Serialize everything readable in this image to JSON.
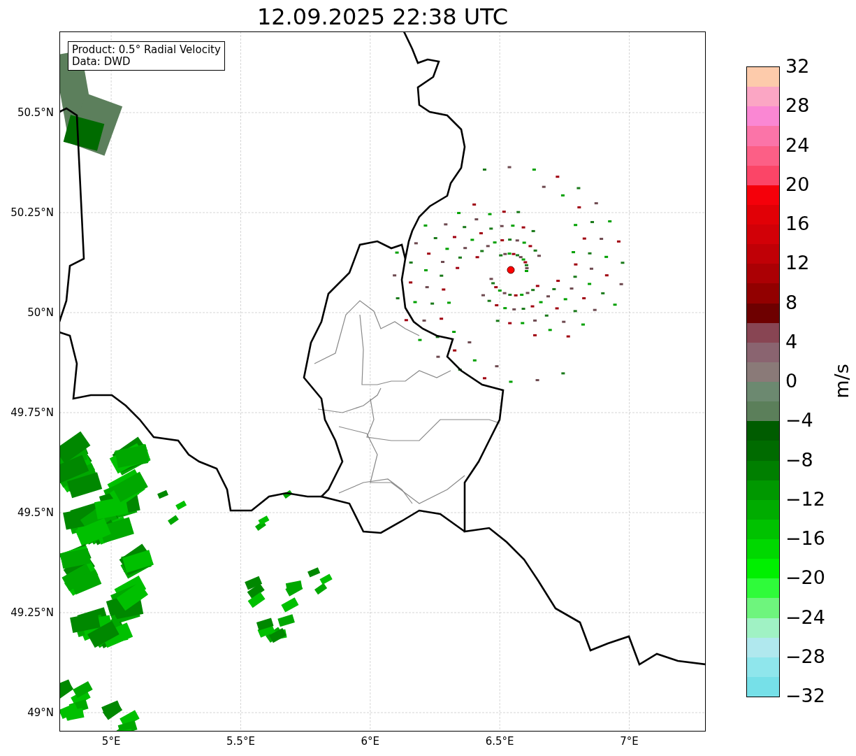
{
  "title": "12.09.2025 22:38 UTC",
  "legend": [
    "Product: 0.5° Radial Velocity",
    "Data: DWD"
  ],
  "y_axis_labels": [
    "50.5°N",
    "50.25°N",
    "50°N",
    "49.75°N",
    "49.5°N",
    "49.25°N",
    "49°N"
  ],
  "x_axis_labels": [
    "5°E",
    "5.5°E",
    "6°E",
    "6.5°E",
    "7°E"
  ],
  "colorbar": {
    "label": "m/s",
    "ticks": [
      "32",
      "28",
      "24",
      "20",
      "16",
      "12",
      "8",
      "4",
      "0",
      "−4",
      "−8",
      "−12",
      "−16",
      "−20",
      "−24",
      "−28",
      "−32"
    ],
    "segments": [
      {
        "color": "#fdcbab"
      },
      {
        "color": "#fba6c4"
      },
      {
        "color": "#fa87d3"
      },
      {
        "color": "#fb74a8"
      },
      {
        "color": "#fc5f86"
      },
      {
        "color": "#fb4567"
      },
      {
        "color": "#f5000a"
      },
      {
        "color": "#e10006"
      },
      {
        "color": "#d20007"
      },
      {
        "color": "#c00006"
      },
      {
        "color": "#ab0004"
      },
      {
        "color": "#920000"
      },
      {
        "color": "#6e0000"
      },
      {
        "color": "#884553"
      },
      {
        "color": "#8a6470"
      },
      {
        "color": "#8a7a78"
      },
      {
        "color": "#6c8970"
      },
      {
        "color": "#5b7f5a"
      },
      {
        "color": "#005c00"
      },
      {
        "color": "#006b00"
      },
      {
        "color": "#007f00"
      },
      {
        "color": "#009800"
      },
      {
        "color": "#00ac00"
      },
      {
        "color": "#00c200"
      },
      {
        "color": "#00d800"
      },
      {
        "color": "#00f000"
      },
      {
        "color": "#2ffb3a"
      },
      {
        "color": "#6ef57d"
      },
      {
        "color": "#a0f2c4"
      },
      {
        "color": "#b0e8ee"
      },
      {
        "color": "#8fe6ec"
      },
      {
        "color": "#76e0e8"
      }
    ]
  }
}
